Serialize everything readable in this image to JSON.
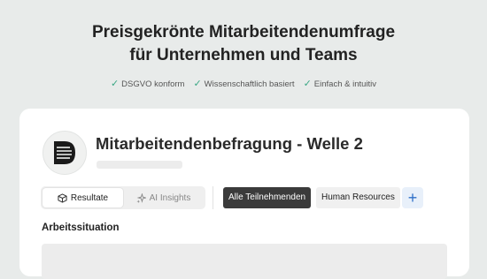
{
  "hero": {
    "title_line1": "Preisgekrönte Mitarbeitendenumfrage",
    "title_line2": "für Unternehmen und Teams"
  },
  "badges": [
    {
      "icon": "check-icon",
      "label": "DSGVO konform"
    },
    {
      "icon": "check-icon",
      "label": "Wissenschaftlich basiert"
    },
    {
      "icon": "check-icon",
      "label": "Einfach & intuitiv"
    }
  ],
  "survey": {
    "title": "Mitarbeitendenbefragung - Welle 2",
    "logo_icon": "company-logo-icon"
  },
  "tabs": [
    {
      "label": "Resultate",
      "icon": "cube-icon",
      "active": true
    },
    {
      "label": "AI Insights",
      "icon": "sparkle-icon",
      "active": false
    }
  ],
  "filters": {
    "selected": "Alle Teilnehmenden",
    "department": "Human Resources",
    "add_icon": "plus-icon"
  },
  "section": {
    "title": "Arbeitssituation"
  },
  "colors": {
    "accent_check": "#3aa784",
    "accent_blue": "#2e6fc8",
    "dark_chip": "#3b3b3b"
  }
}
